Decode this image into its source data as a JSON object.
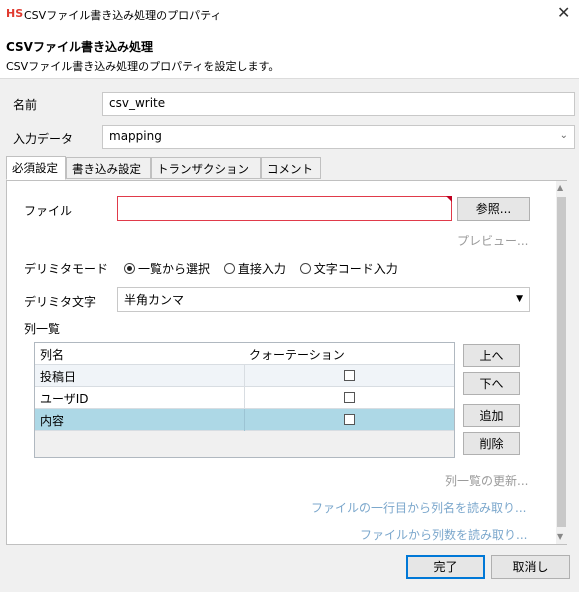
{
  "window": {
    "logo": "HS",
    "title": "CSVファイル書き込み処理のプロパティ",
    "close": "✕"
  },
  "header": {
    "title": "CSVファイル書き込み処理",
    "description": "CSVファイル書き込み処理のプロパティを設定します。"
  },
  "form": {
    "name_label": "名前",
    "name_value": "csv_write",
    "input_label": "入力データ",
    "input_value": "mapping"
  },
  "tabs": [
    "必須設定",
    "書き込み設定",
    "トランザクション",
    "コメント"
  ],
  "required": {
    "file_label": "ファイル",
    "file_value": "",
    "browse_button": "参照...",
    "preview_link": "プレビュー...",
    "delimiter_mode_label": "デリミタモード",
    "delimiter_modes": [
      "一覧から選択",
      "直接入力",
      "文字コード入力"
    ],
    "delimiter_mode_selected": 0,
    "delimiter_char_label": "デリミタ文字",
    "delimiter_char_value": "半角カンマ",
    "column_list_label": "列一覧",
    "columns_header": [
      "列名",
      "クォーテーション"
    ],
    "columns": [
      {
        "name": "投稿日",
        "quoted": false
      },
      {
        "name": "ユーザID",
        "quoted": false
      },
      {
        "name": "内容",
        "quoted": false
      }
    ],
    "side_buttons": {
      "up": "上へ",
      "down": "下へ",
      "add": "追加",
      "delete": "削除"
    },
    "links": {
      "update": "列一覧の更新...",
      "read_header": "ファイルの一行目から列名を読み取り...",
      "read_count": "ファイルから列数を読み取り..."
    }
  },
  "footer": {
    "ok": "完了",
    "cancel": "取消し"
  },
  "colors": {
    "accent": "#0078d7",
    "error_border": "#e03a4a",
    "selected_row": "#add8e6",
    "link": "#9a9a9a",
    "logo": "#e03a2f"
  }
}
